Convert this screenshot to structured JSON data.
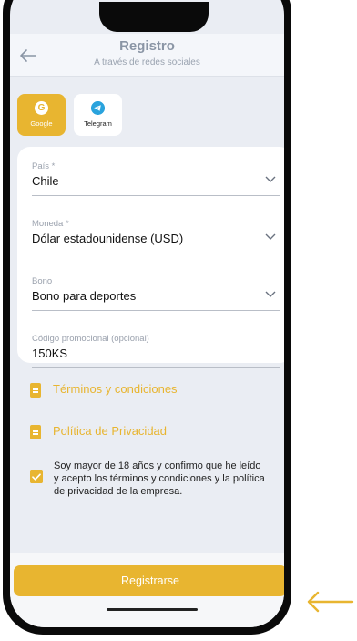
{
  "header": {
    "title": "Registro",
    "subtitle": "A través de redes sociales"
  },
  "social": [
    {
      "label": "Google",
      "icon": "google-icon"
    },
    {
      "label": "Telegram",
      "icon": "telegram-icon"
    }
  ],
  "form": {
    "country": {
      "label": "País *",
      "value": "Chile"
    },
    "currency": {
      "label": "Moneda *",
      "value": "Dólar estadounidense (USD)"
    },
    "bonus": {
      "label": "Bono",
      "value": "Bono para deportes"
    },
    "promo": {
      "label": "Código promocional (opcional)",
      "value": "150KS"
    }
  },
  "links": {
    "terms": "Términos y condiciones",
    "privacy": "Política de Privacidad"
  },
  "consent": {
    "checked": true,
    "text": "Soy mayor de 18 años y confirmo que he leído y acepto los términos y condiciones y la política de privacidad de la empresa."
  },
  "submit_label": "Registrarse",
  "colors": {
    "accent": "#e8b530",
    "background": "#eaedf3"
  }
}
